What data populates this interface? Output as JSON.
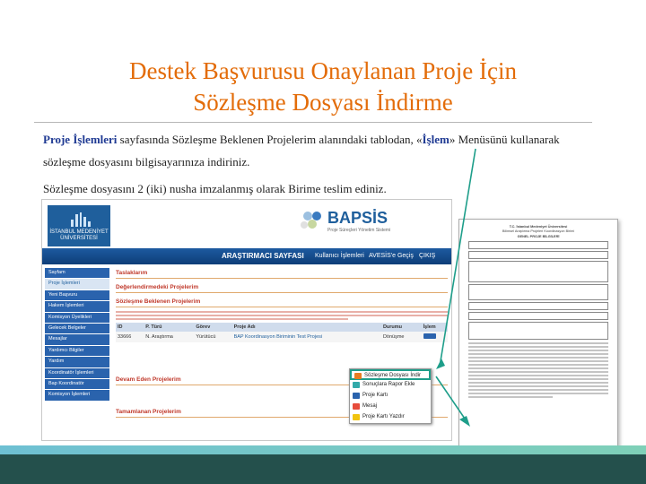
{
  "slide": {
    "title_line1": "Destek Başvurusu Onaylanan Proje İçin",
    "title_line2": "Sözleşme Dosyası İndirme",
    "para1_lead": "Proje İşlemleri",
    "para1_mid": " sayfasında Sözleşme Beklenen Projelerim alanındaki tablodan, «",
    "para1_islem": "İşlem",
    "para1_tail": "» Menüsünü kullanarak",
    "para1_line2": "sözleşme dosyasını bilgisayarınıza indiriniz.",
    "para2": "Sözleşme dosyasını 2 (iki) nusha imzalanmış olarak Birime teslim ediniz.",
    "colors": {
      "title": "#e36c09",
      "accent": "#1f3a93",
      "footer": "#24504c",
      "arrow": "#1e9e8a"
    }
  },
  "shot": {
    "logo_text": "İSTANBUL MEDENİYET ÜNİVERSİTESİ",
    "brand": "BAPSİS",
    "brand_sub": "Proje Süreçleri Yönetim Sistemi",
    "nav_title": "ARAŞTIRMACI SAYFASI",
    "nav_user": "Kullanıcı İşlemleri",
    "nav_login": "AVESİS'e Geçiş",
    "nav_exit": "ÇIKIŞ",
    "sidebar": [
      "Sayfam",
      "Proje İşlemleri",
      "Yeni Başvuru",
      "Hakem İşlemleri",
      "Komisyon Üyelikleri",
      "Gelecek Belgeler",
      "Mesajlar",
      "Yardımcı Bilgiler",
      "Yardım",
      "Koordinatör İşlemleri",
      "Bap Koordinatör",
      "Komisyon İşlemleri"
    ],
    "sections": [
      "Taslaklarım",
      "Değerlendirmedeki Projelerim",
      "Sözleşme Beklenen Projelerim",
      "Devam Eden Projelerim",
      "Tamamlanan Projelerim"
    ],
    "table_headers": [
      "ID",
      "P. Türü",
      "Görev",
      "Proje Adı",
      "Durumu",
      "İşlem"
    ],
    "table_row": [
      "33666",
      "N. Araştırma",
      "Yürütücü",
      "BAP Koordinasyon Biriminin Test Projesi",
      "Dönüşme"
    ],
    "popup": [
      "Sözleşme Dosyası İndir",
      "Sonuçlara Rapor Ekle",
      "Proje Kartı",
      "Mesaj",
      "Proje Kartı Yazdır"
    ],
    "doc_title": "T.C. İstanbul Medeniyet Üniversitesi",
    "doc_sub": "Bilimsel Araştırma Projeleri Koordinasyon Birimi",
    "doc_heading": "GENEL PROJE BİLGİLERİ"
  }
}
